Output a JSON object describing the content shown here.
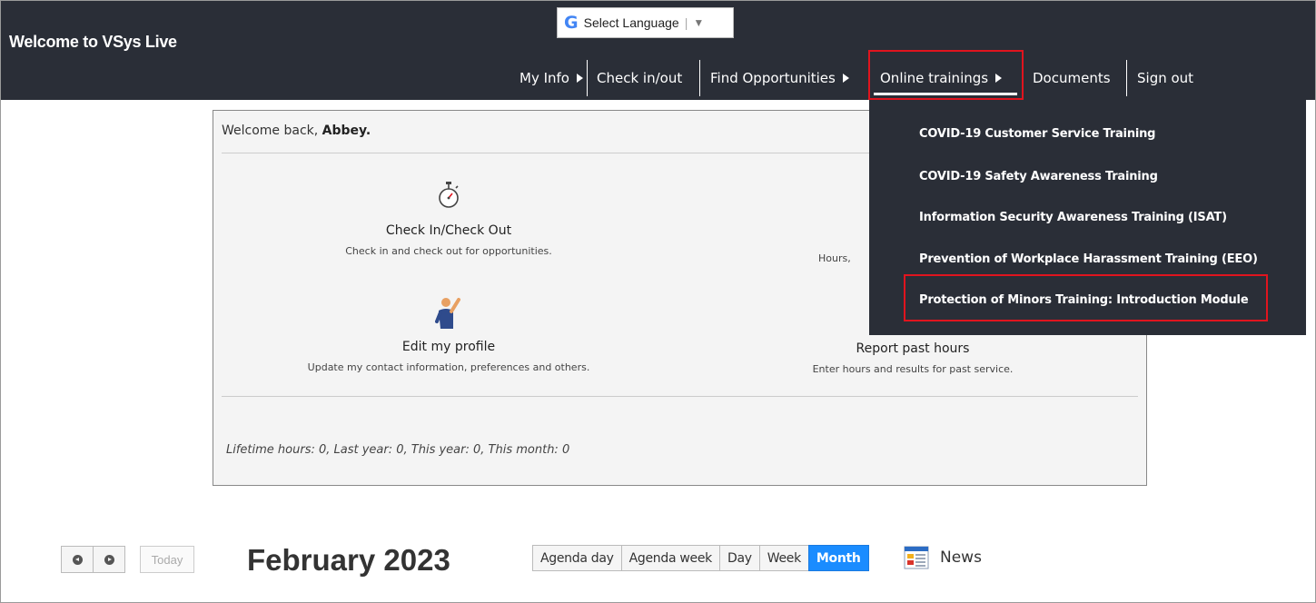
{
  "header": {
    "site_title": "Welcome to VSys Live",
    "language": {
      "label": "Select Language",
      "arrow": "▼",
      "logo": "G"
    },
    "nav": [
      {
        "label": "My Info",
        "has_arrow": true
      },
      {
        "label": "Check in/out",
        "has_arrow": false
      },
      {
        "label": "Find Opportunities",
        "has_arrow": true
      },
      {
        "label": "Online trainings",
        "has_arrow": true,
        "active": true
      },
      {
        "label": "Documents",
        "has_arrow": false
      },
      {
        "label": "Sign out",
        "has_arrow": false
      }
    ]
  },
  "dropdown": {
    "items": [
      "COVID-19 Customer Service Training",
      "COVID-19 Safety Awareness Training",
      "Information Security Awareness Training (ISAT)",
      "Prevention of Workplace Harassment Training (EEO)",
      "Protection of Minors Training: Introduction Module"
    ]
  },
  "panel": {
    "welcome_prefix": "Welcome back, ",
    "user_name": "Abbey.",
    "tiles": {
      "checkin": {
        "title": "Check In/Check Out",
        "desc": "Check in and check out for opportunities.",
        "icon": "stopwatch-icon"
      },
      "hours": {
        "desc": "Hours,"
      },
      "profile": {
        "title": "Edit my profile",
        "desc": "Update my contact information, preferences and others.",
        "icon": "person-waving-icon"
      },
      "report": {
        "title": "Report past hours",
        "desc": "Enter hours and results for past service."
      }
    },
    "lifetime": "Lifetime hours: 0, Last year: 0, This year: 0, This month: 0"
  },
  "calendar": {
    "today_label": "Today",
    "title": "February 2023",
    "views": [
      "Agenda day",
      "Agenda week",
      "Day",
      "Week",
      "Month"
    ],
    "active_view": "Month",
    "news_label": "News"
  },
  "colors": {
    "header_bg": "#2a2e37",
    "highlight": "#e0141e",
    "active_view": "#1a8cff"
  }
}
